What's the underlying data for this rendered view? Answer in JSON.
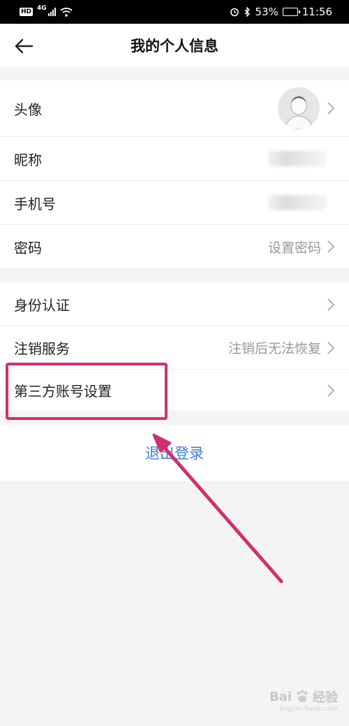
{
  "status_bar": {
    "hd": "HD",
    "network": "4G",
    "alarm_icon": "alarm-icon",
    "bluetooth_icon": "bluetooth-icon",
    "battery_percent": "53%",
    "battery_level": 0.53,
    "time": "11:56"
  },
  "header": {
    "title": "我的个人信息",
    "back_icon": "arrow-left-icon"
  },
  "profile_section": {
    "avatar": {
      "label": "头像"
    },
    "nickname": {
      "label": "昵称"
    },
    "phone": {
      "label": "手机号"
    },
    "password": {
      "label": "密码",
      "value": "设置密码"
    }
  },
  "account_section": {
    "identity": {
      "label": "身份认证"
    },
    "cancel": {
      "label": "注销服务",
      "value": "注销后无法恢复"
    },
    "third_party": {
      "label": "第三方账号设置"
    }
  },
  "logout": {
    "label": "退出登录"
  },
  "colors": {
    "link": "#3b7fd2",
    "annotation": "#d0306f",
    "background": "#f4f4f4"
  },
  "watermark": {
    "brand": "Bai",
    "suffix": "经验",
    "sub": "jingyan.baidu.com"
  }
}
